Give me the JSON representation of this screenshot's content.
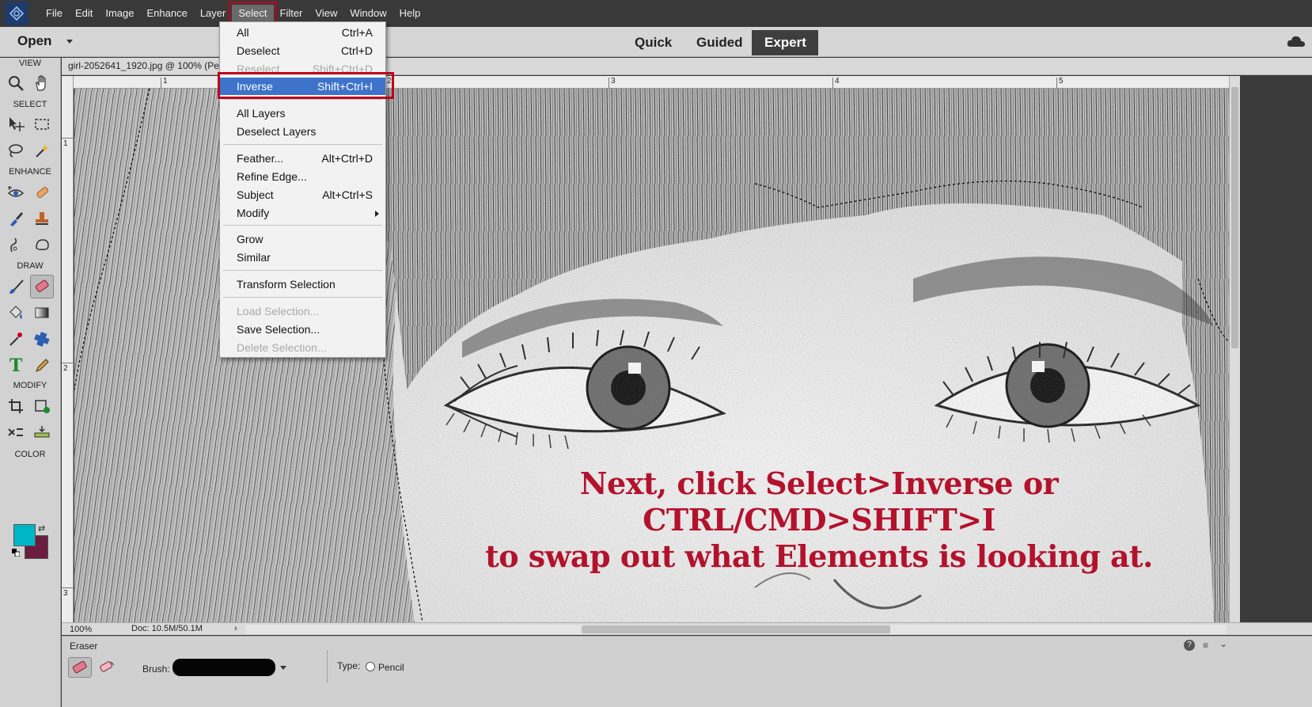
{
  "menubar": {
    "items": [
      "File",
      "Edit",
      "Image",
      "Enhance",
      "Layer",
      "Select",
      "Filter",
      "View",
      "Window",
      "Help"
    ],
    "open_menu": "Select"
  },
  "modebar": {
    "open_label": "Open",
    "tabs": [
      "Quick",
      "Guided",
      "Expert"
    ],
    "active_tab": "Expert"
  },
  "toolbox": {
    "sections": [
      "VIEW",
      "SELECT",
      "ENHANCE",
      "DRAW",
      "MODIFY",
      "COLOR"
    ],
    "view_tools": [
      "zoom-icon",
      "hand-icon"
    ],
    "select_tools": [
      "move-icon",
      "marquee-icon",
      "lasso-icon",
      "magic-wand-icon"
    ],
    "enhance_tools": [
      "eye-icon",
      "spot-healing-icon",
      "smart-brush-icon",
      "clone-stamp-icon",
      "blur-icon",
      "sponge-icon"
    ],
    "draw_tools": [
      "brush-icon",
      "eraser-icon",
      "paint-bucket-icon",
      "gradient-icon",
      "color-picker-icon",
      "custom-shape-icon",
      "type-icon",
      "pencil-icon"
    ],
    "modify_tools": [
      "crop-icon",
      "recompose-icon",
      "content-aware-move-icon",
      "straighten-icon"
    ],
    "fg_color": "#00b5c5",
    "bg_color": "#6b1d3f"
  },
  "document": {
    "title": "girl-2052641_1920.jpg @ 100% (Pe",
    "ruler_top": [
      "1",
      "2",
      "3",
      "4",
      "5"
    ],
    "ruler_left": [
      "1",
      "2",
      "3"
    ]
  },
  "status": {
    "zoom": "100%",
    "doc_size": "Doc: 10.5M/50.1M"
  },
  "options": {
    "tool_name": "Eraser",
    "brush_label": "Brush:",
    "type_label": "Type:",
    "pencil_label": "Pencil"
  },
  "select_menu": {
    "items": [
      {
        "label": "All",
        "shortcut": "Ctrl+A",
        "disabled": false
      },
      {
        "label": "Deselect",
        "shortcut": "Ctrl+D",
        "disabled": false
      },
      {
        "label": "Reselect",
        "shortcut": "Shift+Ctrl+D",
        "disabled": true
      },
      {
        "label": "Inverse",
        "shortcut": "Shift+Ctrl+I",
        "disabled": false,
        "highlighted": true
      },
      {
        "label": "All Layers",
        "shortcut": "",
        "disabled": false
      },
      {
        "label": "Deselect Layers",
        "shortcut": "",
        "disabled": false
      },
      {
        "label": "Feather...",
        "shortcut": "Alt+Ctrl+D",
        "disabled": false
      },
      {
        "label": "Refine Edge...",
        "shortcut": "",
        "disabled": false
      },
      {
        "label": "Subject",
        "shortcut": "Alt+Ctrl+S",
        "disabled": false
      },
      {
        "label": "Modify",
        "shortcut": "",
        "disabled": false,
        "submenu": true
      },
      {
        "label": "Grow",
        "shortcut": "",
        "disabled": false
      },
      {
        "label": "Similar",
        "shortcut": "",
        "disabled": false
      },
      {
        "label": "Transform Selection",
        "shortcut": "",
        "disabled": false
      },
      {
        "label": "Load Selection...",
        "shortcut": "",
        "disabled": true
      },
      {
        "label": "Save Selection...",
        "shortcut": "",
        "disabled": false
      },
      {
        "label": "Delete Selection...",
        "shortcut": "",
        "disabled": true
      }
    ]
  },
  "caption": {
    "line1": "Next, click Select>Inverse or CTRL/CMD>SHIFT>I",
    "line2": "to swap out what Elements is looking at.",
    "color": "#b3122c"
  }
}
